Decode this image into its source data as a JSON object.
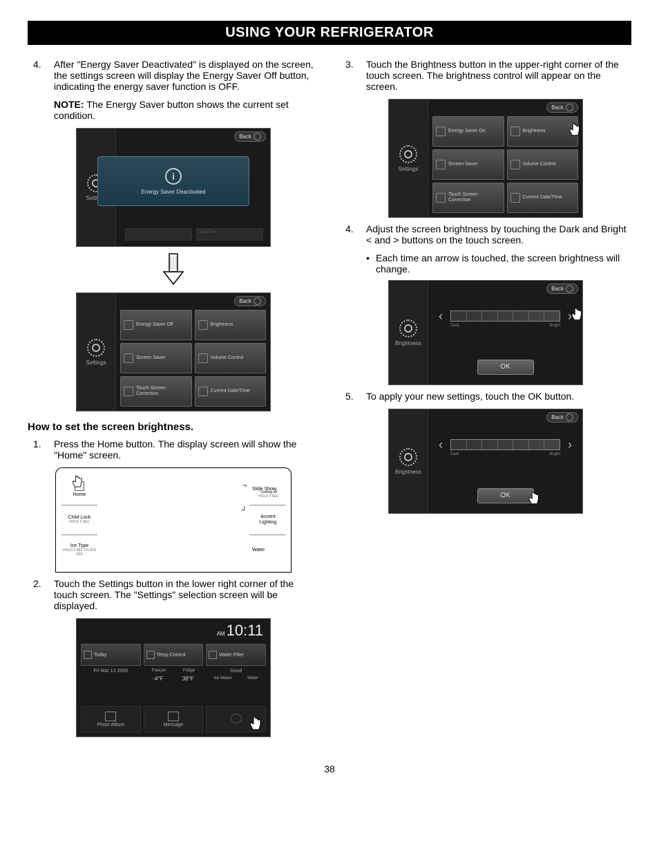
{
  "header": "USING YOUR REFRIGERATOR",
  "pageNumber": "38",
  "left": {
    "step4": {
      "num": "4.",
      "text": "After \"Energy Saver Deactivated\" is displayed on the screen, the settings screen will display the Energy Saver Off button, indicating the energy saver function is OFF."
    },
    "noteLabel": "NOTE:",
    "noteText": " The Energy Saver button shows the current set condition.",
    "dialogScreen": {
      "back": "Back",
      "sideLabel": "Settings",
      "dialogText": "Energy Saver Deactivated",
      "faint1": "",
      "faint2": "Date/Time"
    },
    "settingsScreen": {
      "back": "Back",
      "sideLabel": "Settings",
      "tiles": [
        "Energy Saver Off",
        "Brightness",
        "Screen Saver",
        "Volume Control",
        "Touch Screen Correction",
        "Current Date/Time"
      ]
    },
    "subHeading": "How to set the screen brightness.",
    "step1": {
      "num": "1.",
      "text": "Press the Home button. The display screen will show the \"Home\" screen."
    },
    "homeScreen": {
      "leftBtns": [
        {
          "label": "Home",
          "sub": ""
        },
        {
          "label": "Child Lock",
          "sub": "HOLD 3 SEC"
        },
        {
          "label": "Ice Type",
          "sub": "HOLD 3 SEC FILTER OFF"
        }
      ],
      "rightBtns": [
        {
          "label": "Slide Show",
          "sub": ""
        },
        {
          "group": "Cooling off",
          "groupSub": "HOLD 3 SEC"
        },
        {
          "label": "Accent Lighting",
          "sub": ""
        },
        {
          "label": "Water",
          "sub": ""
        }
      ]
    },
    "step2": {
      "num": "2.",
      "text": "Touch the Settings button in the lower right corner of the touch screen. The \"Settings\" selection screen will be displayed."
    },
    "clockScreen": {
      "am": "AM",
      "time": "10:11",
      "row1": [
        "Today",
        "Temp Control",
        "Water Filter"
      ],
      "date": "Fri Mar 13 2009",
      "tempLabels": [
        "Freezer",
        "Fridge"
      ],
      "temps": [
        "-4°F",
        "38°F"
      ],
      "filterStatus": "Good",
      "iceLabels": [
        "Ice Maker",
        "Water"
      ],
      "row3": [
        "Photo Album",
        "Message",
        ""
      ]
    }
  },
  "right": {
    "step3": {
      "num": "3.",
      "text": "Touch the Brightness button in the upper-right corner of the touch screen. The brightness control will appear on the screen."
    },
    "settingsScreen": {
      "back": "Back",
      "sideLabel": "Settings",
      "tiles": [
        "Energy Saver On",
        "Brightness",
        "Screen Saver",
        "Volume Control",
        "Touch Screen Correction",
        "Current Date/Time"
      ]
    },
    "step4": {
      "num": "4.",
      "text": "Adjust the screen brightness by touching the Dark and Bright < and > buttons on the touch screen."
    },
    "bullet": {
      "dot": "•",
      "text": "Each time an arrow is touched, the screen brightness will change."
    },
    "brightScreen1": {
      "back": "Back",
      "sideLabel": "Brightness",
      "dark": "Dark",
      "bright": "Bright",
      "ok": "OK"
    },
    "step5": {
      "num": "5.",
      "text": "To apply your new settings, touch the OK button."
    },
    "brightScreen2": {
      "back": "Back",
      "sideLabel": "Brightness",
      "dark": "Dark",
      "bright": "Bright",
      "ok": "OK"
    }
  }
}
